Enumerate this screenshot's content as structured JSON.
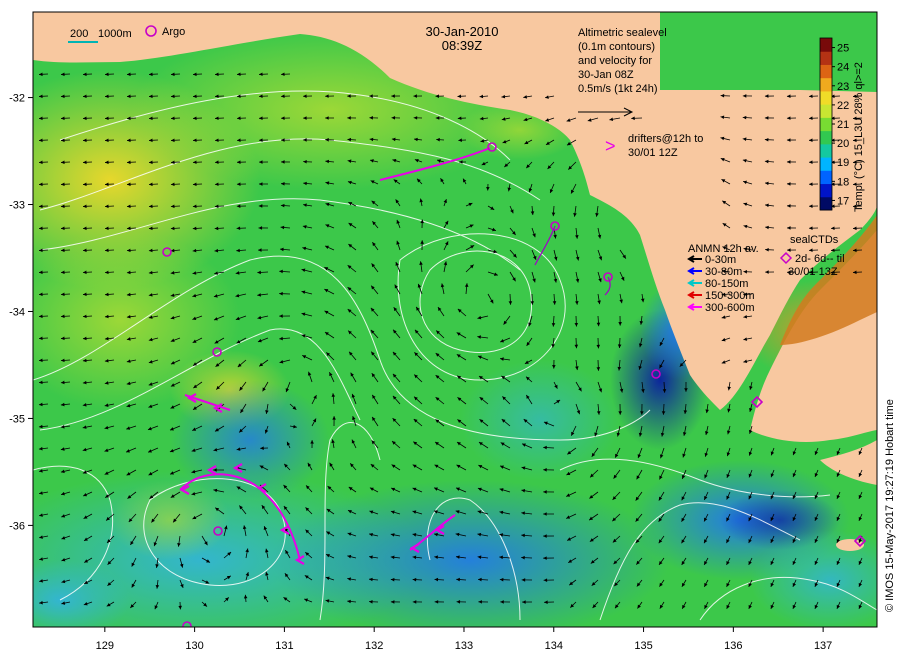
{
  "header": {
    "date": "30-Jan-2010",
    "time": "08:39Z"
  },
  "scale_bar": {
    "label_200": "200",
    "label_1000": "1000m"
  },
  "argo_legend": {
    "label": "Argo"
  },
  "altimetry_note": {
    "lines": [
      "Altimetric sealevel",
      "(0.1m contours)",
      "and velocity for",
      "30-Jan 08Z",
      "0.5m/s (1kt 24h)"
    ]
  },
  "drifters_legend": {
    "symbol": ">",
    "lines": [
      "drifters@12h to",
      "30/01 12Z"
    ]
  },
  "anmn_legend": {
    "title": "ANMN 12h av.",
    "items": [
      {
        "label": "0-30m",
        "color": "#000000"
      },
      {
        "label": "30-80m",
        "color": "#0000ff"
      },
      {
        "label": "80-150m",
        "color": "#00c8c8"
      },
      {
        "label": "150-300m",
        "color": "#e00000"
      },
      {
        "label": "300-600m",
        "color": "#ff00ff"
      }
    ]
  },
  "sealctd_legend": {
    "title": "sealCTDs",
    "line1": "2d- 6d-- til",
    "line2": "30/01 13Z"
  },
  "colorbar": {
    "title": "Temp. (°C) 15_L3U 28% ql>=2",
    "ticks": [
      "17",
      "18",
      "19",
      "20",
      "21",
      "22",
      "23",
      "24",
      "25"
    ],
    "min": 16.5,
    "max": 25.5,
    "colors": [
      "#000a64",
      "#0014c8",
      "#0064ff",
      "#00b4ff",
      "#14c8a0",
      "#32c850",
      "#78dc32",
      "#c8e632",
      "#f0dc28",
      "#f0aa1e",
      "#dc6414",
      "#b43214",
      "#780a0a"
    ]
  },
  "axes": {
    "x_ticks": [
      "129",
      "130",
      "131",
      "132",
      "133",
      "134",
      "135",
      "136",
      "137"
    ],
    "y_ticks": [
      "-32",
      "-33",
      "-34",
      "-35",
      "-36"
    ],
    "lon_range": [
      128.2,
      137.6
    ],
    "lat_range": [
      -36.95,
      -31.2
    ]
  },
  "credit": "© IMOS 15-May-2017 19:27:19 Hobart time",
  "colors": {
    "land": "#f8c8a0",
    "contour": "#ffffff",
    "arrow": "#000000",
    "argo": "#c800c8",
    "drifter": "#e800e8",
    "sealctd": "#c800c8"
  }
}
